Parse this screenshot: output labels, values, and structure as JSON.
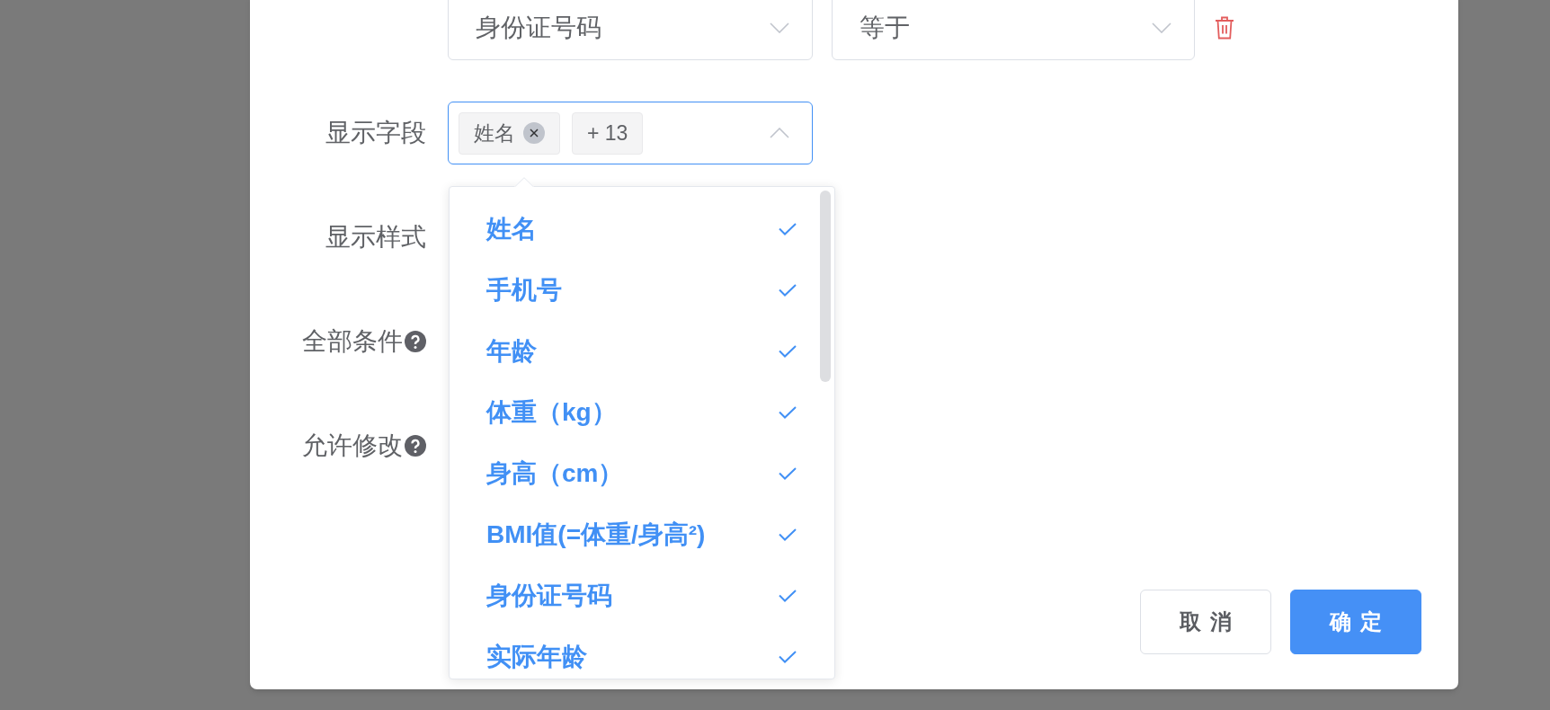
{
  "filter_row": {
    "field": "身份证号码",
    "operator": "等于"
  },
  "display_fields": {
    "label": "显示字段",
    "expanded": true,
    "tags": [
      {
        "label": "姓名",
        "closable": true
      },
      {
        "label": "+ 13",
        "closable": false
      }
    ],
    "options": [
      {
        "label": "姓名",
        "selected": true
      },
      {
        "label": "手机号",
        "selected": true
      },
      {
        "label": "年龄",
        "selected": true
      },
      {
        "label": "体重（kg）",
        "selected": true
      },
      {
        "label": "身高（cm）",
        "selected": true
      },
      {
        "label": "BMI值(=体重/身高²)",
        "selected": true
      },
      {
        "label": "身份证号码",
        "selected": true
      },
      {
        "label": "实际年龄",
        "selected": true
      }
    ]
  },
  "other_fields": [
    {
      "label": "显示样式",
      "help": false
    },
    {
      "label": "全部条件",
      "help": true
    },
    {
      "label": "允许修改",
      "help": true
    }
  ],
  "buttons": [
    {
      "label": "取消",
      "kind": "default"
    },
    {
      "label": "确定",
      "kind": "primary"
    }
  ]
}
